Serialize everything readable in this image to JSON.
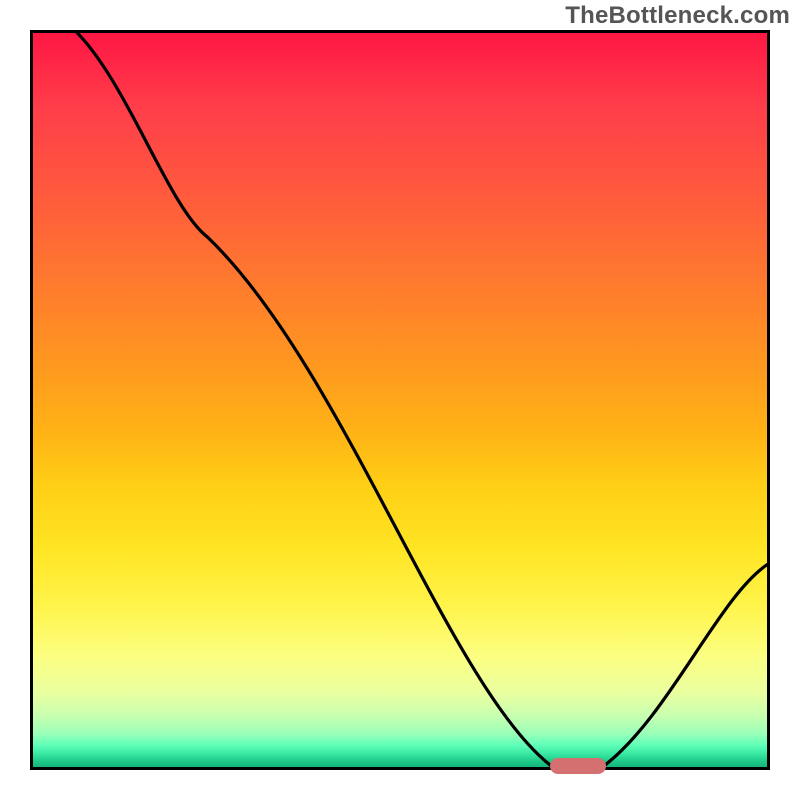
{
  "watermark": "TheBottleneck.com",
  "chart_data": {
    "type": "line",
    "title": "",
    "xlabel": "",
    "ylabel": "",
    "xlim": [
      0,
      100
    ],
    "ylim": [
      0,
      100
    ],
    "x": [
      6,
      24,
      70.5,
      77.5,
      100
    ],
    "values": [
      100,
      72,
      0.5,
      0.5,
      28
    ],
    "grid": false,
    "legend": false,
    "background_gradient": [
      "#ff1744",
      "#ff7a2e",
      "#ffd016",
      "#fcff82",
      "#12b67a"
    ],
    "marker": {
      "x": 74,
      "y": 0.5,
      "color": "#d4706f",
      "shape": "pill"
    },
    "notes": "Curve starts top-left, descends with slight knee near x≈24, reaches a flat minimum around x≈70–78 near y≈0, then rises again to y≈28 at x=100. Values are percentages read off the plot area."
  }
}
